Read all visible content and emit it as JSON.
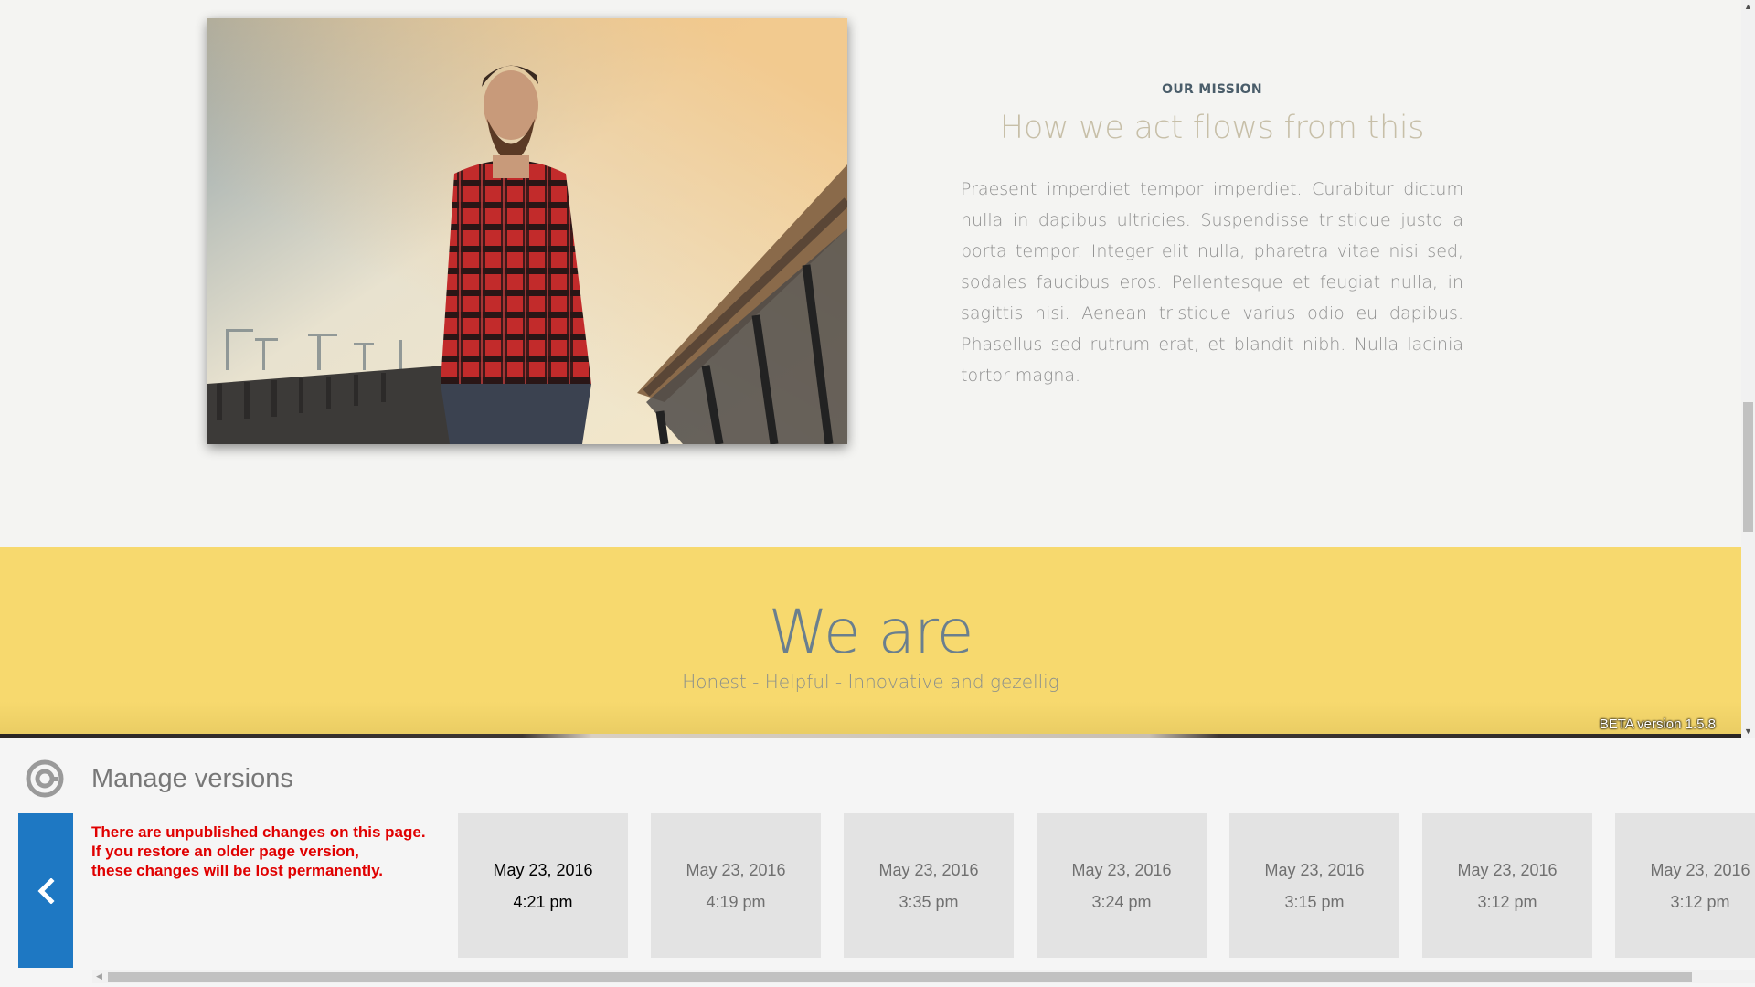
{
  "mission": {
    "eyebrow": "OUR MISSION",
    "heading": "How we act flows from this",
    "body": "Praesent imperdiet tempor imperdiet. Curabitur dictum nulla in dapibus ultricies. Suspendisse tristique justo a porta tempor. Integer elit nulla, pharetra vitae nisi sed, sodales faucibus eros. Pellentesque et feugiat nulla, in sagittis nisi. Aenean tristique varius odio eu dapibus. Phasellus sed rutrum erat, et blandit nibh. Nulla lacinia tortor magna."
  },
  "we_are": {
    "title": "We are",
    "subtitle": "Honest - Helpful - Innovative and gezellig"
  },
  "beta_label": "BETA version 1.5.8",
  "versions": {
    "title": "Manage versions",
    "warning_lines": [
      "There are unpublished changes on this page.",
      "If you restore an older page version,",
      "these changes will be lost permanently."
    ],
    "items": [
      {
        "date": "May 23, 2016",
        "time": "4:21 pm",
        "active": true
      },
      {
        "date": "May 23, 2016",
        "time": "4:19 pm",
        "active": false
      },
      {
        "date": "May 23, 2016",
        "time": "3:35 pm",
        "active": false
      },
      {
        "date": "May 23, 2016",
        "time": "3:24 pm",
        "active": false
      },
      {
        "date": "May 23, 2016",
        "time": "3:15 pm",
        "active": false
      },
      {
        "date": "May 23, 2016",
        "time": "3:12 pm",
        "active": false
      },
      {
        "date": "May 23, 2016",
        "time": "3:12 pm",
        "active": false
      }
    ]
  },
  "colors": {
    "band": "#f7d96e",
    "accent_blue": "#1e78c3",
    "warning_red": "#e00000"
  },
  "icons": {
    "back": "chevron-left-icon",
    "logo": "versions-logo-icon"
  }
}
